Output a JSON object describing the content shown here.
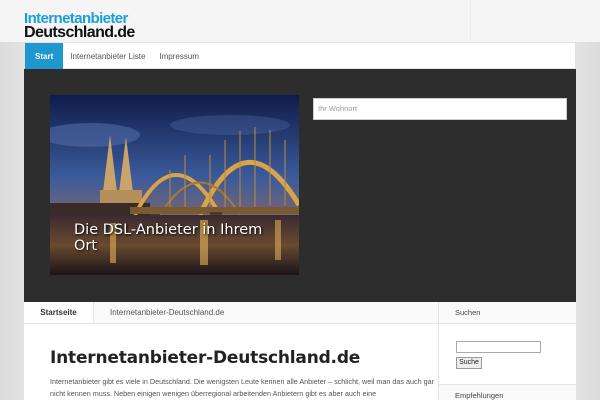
{
  "logo": {
    "line1": "Internetanbieter",
    "line2": "Deutschland.de"
  },
  "nav": {
    "items": [
      {
        "label": "Start",
        "active": true
      },
      {
        "label": "Internetanbieter Liste",
        "active": false
      },
      {
        "label": "Impressum",
        "active": false
      }
    ]
  },
  "hero": {
    "caption": "Die DSL-Anbieter in Ihrem Ort",
    "search_placeholder": "Ihr Wohnort"
  },
  "breadcrumb": {
    "home": "Startseite",
    "current": "Internetanbieter-Deutschland.de"
  },
  "main": {
    "title": "Internetanbieter-Deutschland.de",
    "text": "Internetanbieter gibt es viele in Deutschland. Die wenigsten Leute kennen alle Anbieter – schlicht, weil man das auch gar nicht kennen muss. Neben einigen wenigen überregional arbeitenden Anbietern gibt es aber auch eine"
  },
  "sidebar": {
    "search_title": "Suchen",
    "search_button": "Suche",
    "recommend_title": "Empfehlungen"
  },
  "colors": {
    "accent": "#1f97cf",
    "hero_bg": "#2d2d2d"
  }
}
